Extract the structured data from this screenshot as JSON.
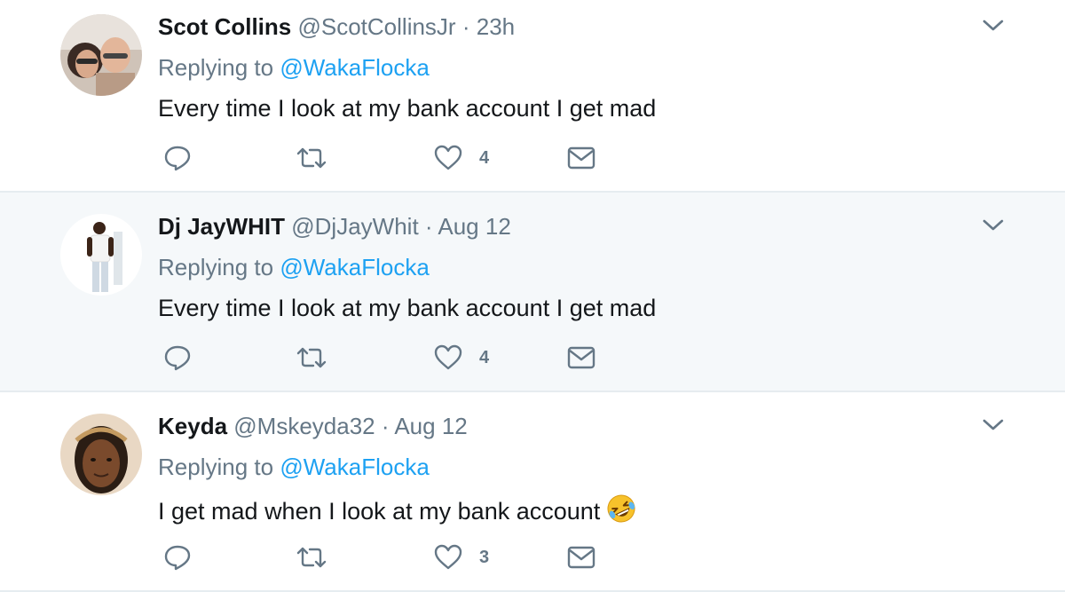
{
  "tweets": [
    {
      "name": "Scot Collins",
      "handle": "@ScotCollinsJr",
      "separator": "·",
      "time": "23h",
      "replying_prefix": "Replying to",
      "replying_to": "@WakaFlocka",
      "text": "Every time I look at my bank account I get mad",
      "like_count": "4"
    },
    {
      "name": "Dj JayWHIT",
      "handle": "@DjJayWhit",
      "separator": "·",
      "time": "Aug 12",
      "replying_prefix": "Replying to",
      "replying_to": "@WakaFlocka",
      "text": "Every time I look at my bank account I get mad",
      "like_count": "4"
    },
    {
      "name": "Keyda",
      "handle": "@Mskeyda32",
      "separator": "·",
      "time": "Aug 12",
      "replying_prefix": "Replying to",
      "replying_to": "@WakaFlocka",
      "text": "I get mad when I look at my bank account",
      "emoji": "rolling-on-floor-laughing-icon",
      "like_count": "3"
    }
  ],
  "colors": {
    "name": "#14171a",
    "secondary": "#657786",
    "link": "#1da1f2",
    "divider": "#e6ecf0",
    "shaded_background": "#f5f8fa"
  }
}
